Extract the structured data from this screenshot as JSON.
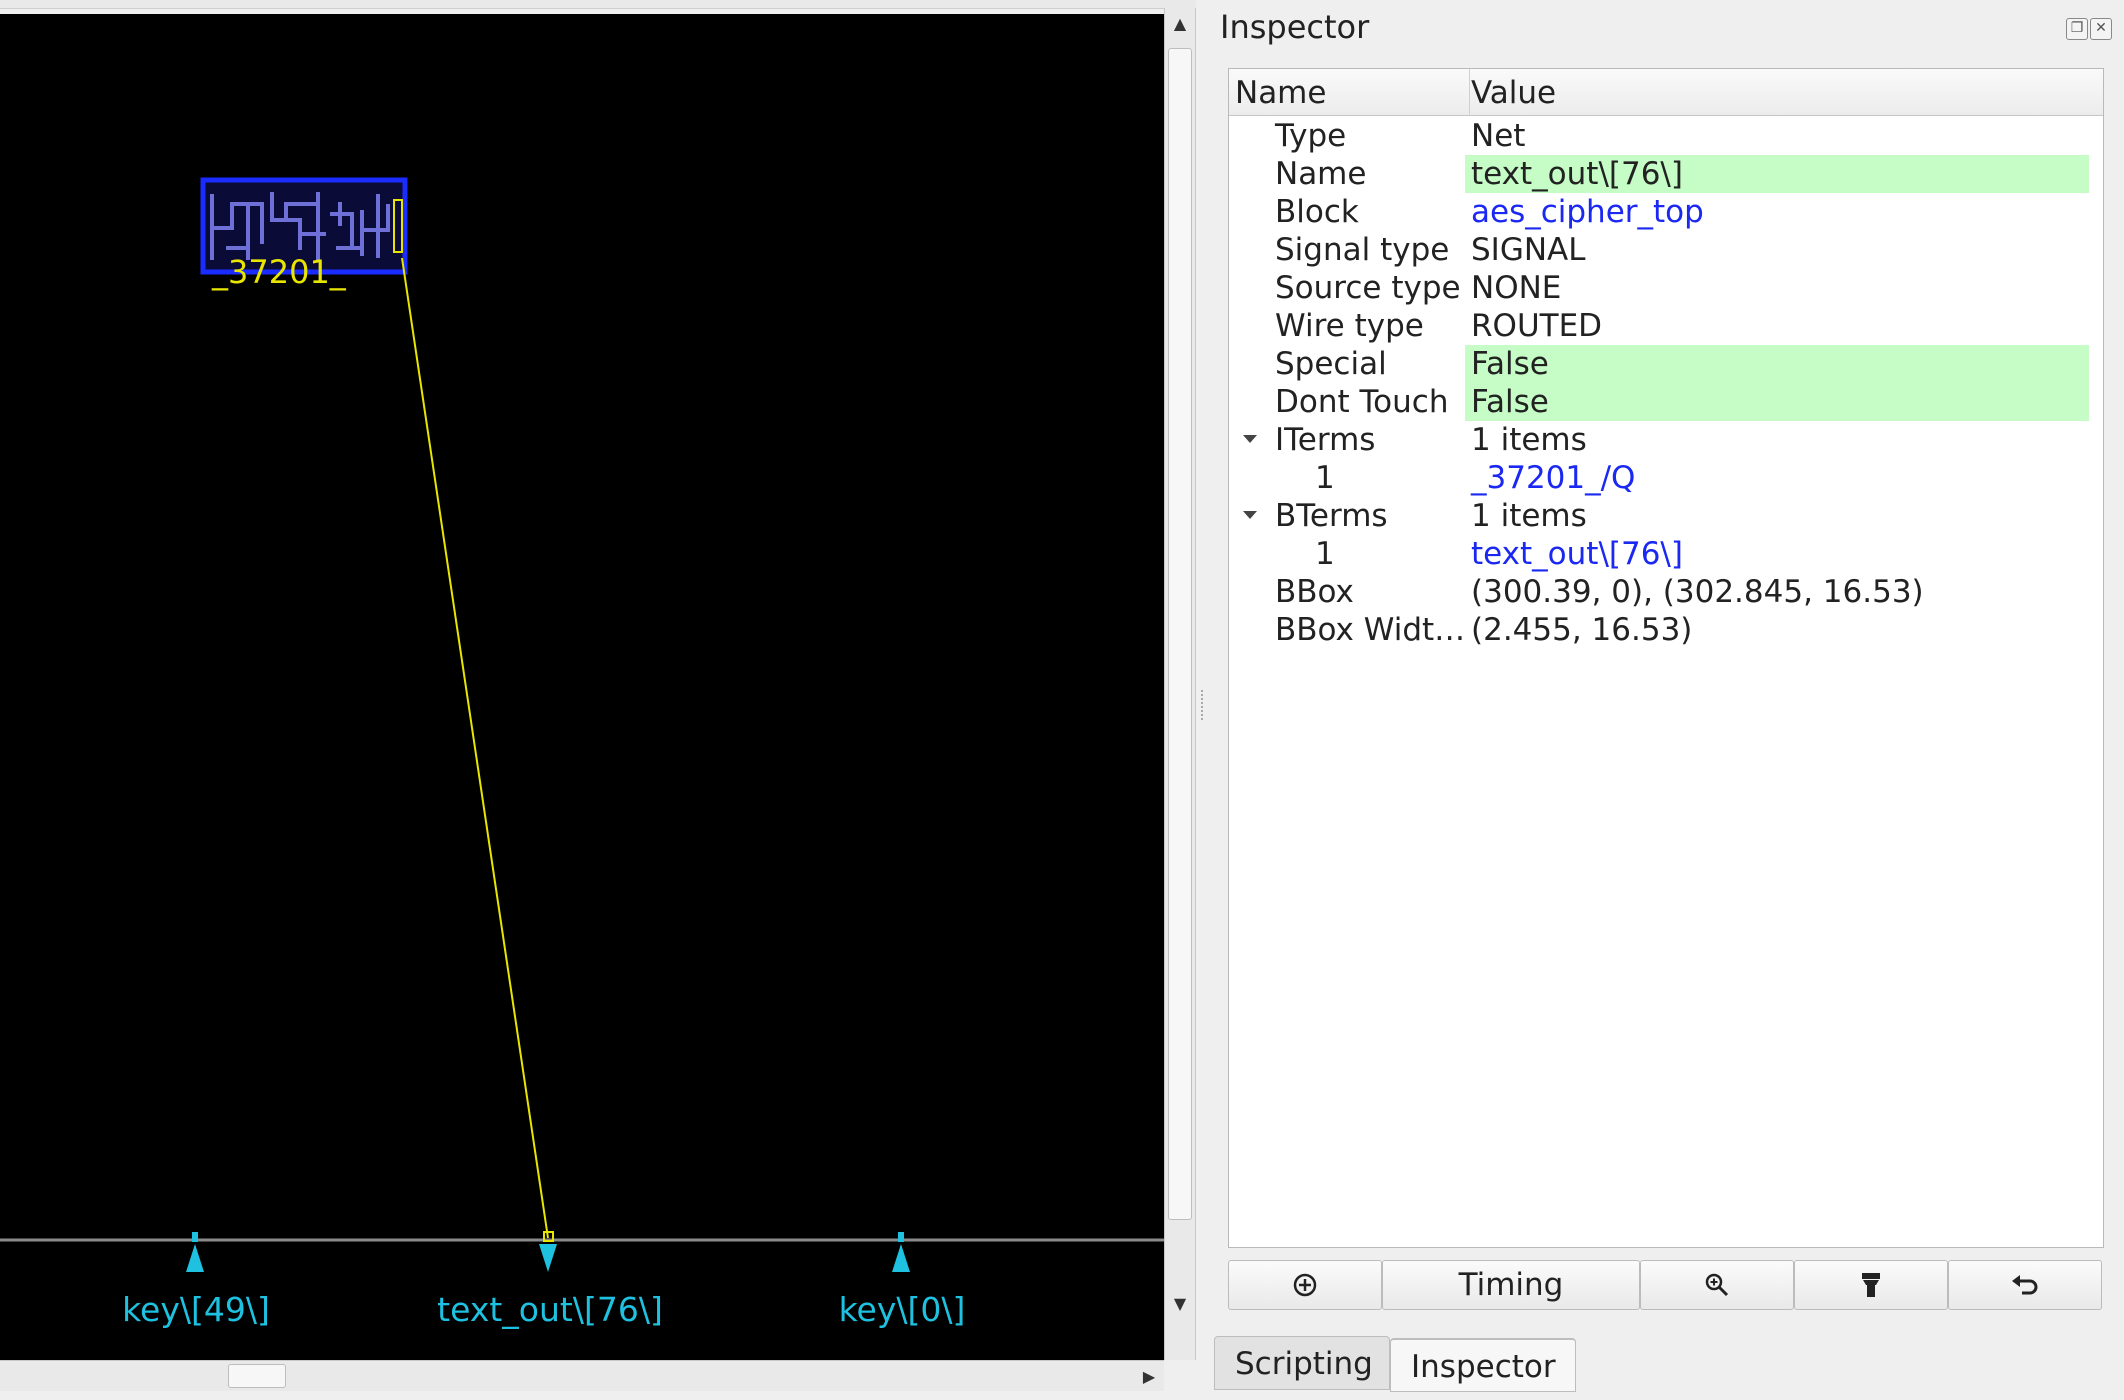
{
  "layout": {
    "cell_label": "_37201_",
    "pins": [
      {
        "label": "key\\[49\\]"
      },
      {
        "label": "text_out\\[76\\]"
      },
      {
        "label": "key\\[0\\]"
      }
    ],
    "colors": {
      "background": "#000000",
      "cell_outline": "#1a2cff",
      "net_highlight": "#e8e600",
      "pin": "#1ec2e0",
      "boundary": "#8a8a8a"
    }
  },
  "inspector": {
    "title": "Inspector",
    "columns": {
      "name": "Name",
      "value": "Value"
    },
    "rows": [
      {
        "name": "Type",
        "value": "Net"
      },
      {
        "name": "Name",
        "value": "text_out\\[76\\]"
      },
      {
        "name": "Block",
        "value": "aes_cipher_top"
      },
      {
        "name": "Signal type",
        "value": "SIGNAL"
      },
      {
        "name": "Source type",
        "value": "NONE"
      },
      {
        "name": "Wire type",
        "value": "ROUTED"
      },
      {
        "name": "Special",
        "value": "False"
      },
      {
        "name": "Dont Touch",
        "value": "False"
      },
      {
        "name": "ITerms",
        "value": "1 items"
      },
      {
        "name": "1",
        "value": "_37201_/Q"
      },
      {
        "name": "BTerms",
        "value": "1 items"
      },
      {
        "name": "1",
        "value": "text_out\\[76\\]"
      },
      {
        "name": "BBox",
        "value": "(300.39, 0), (302.845, 16.53)"
      },
      {
        "name": "BBox Widt…",
        "value": "(2.455, 16.53)"
      }
    ],
    "toolbar": {
      "timing_label": "Timing",
      "icons": [
        "add-highlight-icon",
        "zoom-in-icon",
        "flashlight-icon",
        "undo-icon"
      ]
    }
  },
  "tabs": [
    {
      "label": "Scripting"
    },
    {
      "label": "Inspector",
      "active": true
    }
  ]
}
